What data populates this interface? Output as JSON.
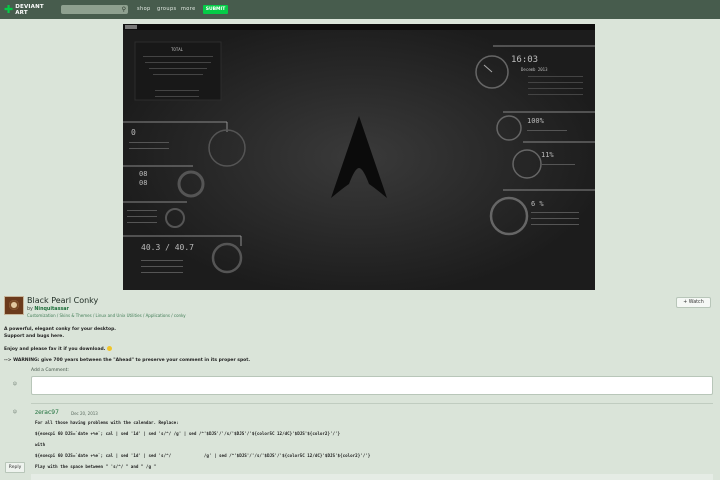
{
  "header": {
    "logo_line1": "DEVIANT",
    "logo_line2": "ART",
    "search_placeholder": "",
    "nav": [
      "shop",
      "groups",
      "more"
    ],
    "submit_label": "SUBMIT"
  },
  "desktop": {
    "clock_top": "16:03",
    "month_title": "Decemb 2013",
    "date_small": "",
    "ram_percent": "100%",
    "cpu_percent": "11%",
    "disk_percent": "6 %",
    "left_big_zero": "0",
    "left_nums": [
      "08",
      "08"
    ],
    "bottom_numbers": "40.3 / 40.7",
    "info_title": "TOTAL"
  },
  "deviation": {
    "title": "Black Pearl Conky",
    "by_label": "by",
    "author": "Ninquitassar",
    "categories": "Customization / Skins & Themes / Linux and Unix Utilities / Applications / conky",
    "watch_label": "+ Watch"
  },
  "description": {
    "line1": "A powerful, elegant conky for your desktop.",
    "line2": "Support and bugs here.",
    "line3": "Enjoy and please fav it if you download. ",
    "line4": "--> WARNING: give 700 years between the \"Ahead\" to preserve your comment in its proper spot."
  },
  "comments": {
    "add_label": "Add a Comment:",
    "items": [
      {
        "user": "zerac97",
        "date": "Dec 20, 2013",
        "lines": [
          "For all those having problems with the calendar. Replace:",
          "${execpi 60 DJS=`date +%e`; cal | sed '1d' | sed 's/^/ /g' | sed /^'$DJS'/'/s/'$DJS'/'${color5C 12/dC}'$DJS'${color2}'/'}",
          "with",
          "${execpi 60 DJS=`date +%e`; cal | sed '1d' | sed 's/^/             /g' | sed /^'$DJS'/'/s/'$DJS'/'${color5C 12/dC}'$DJS'${color2}'/'}",
          "Play with the space between \" 's/^/ \" and \" /g \""
        ]
      }
    ],
    "reply_label": "Reply"
  },
  "colors": {
    "topbar": "#475c4d",
    "accent": "#05cc47",
    "page_bg": "#dae4d9"
  }
}
